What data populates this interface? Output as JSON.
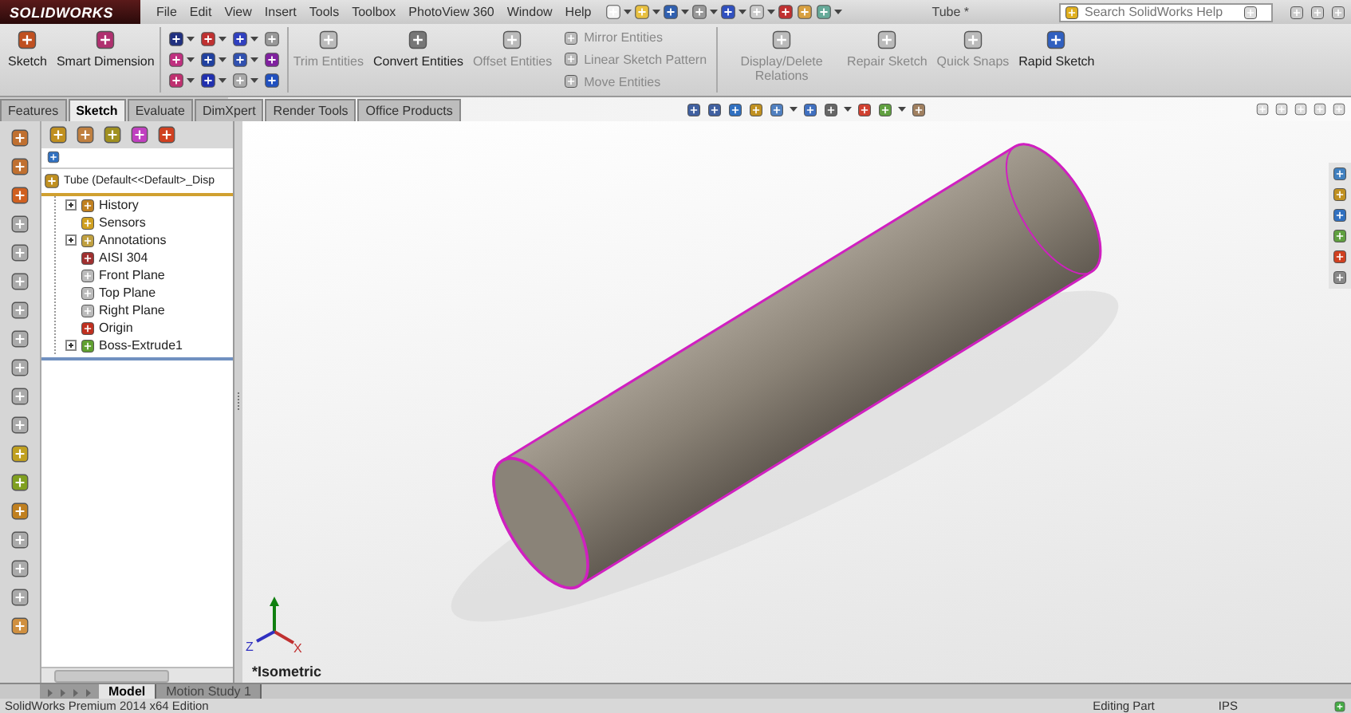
{
  "app": {
    "logo": "SOLIDWORKS",
    "menu": [
      "File",
      "Edit",
      "View",
      "Insert",
      "Tools",
      "Toolbox",
      "PhotoView 360",
      "Window",
      "Help"
    ],
    "document_title": "Tube *",
    "search": {
      "placeholder": "Search SolidWorks Help"
    }
  },
  "command_manager": {
    "commands": [
      {
        "kind": "large",
        "label": "Sketch",
        "disabled": false
      },
      {
        "kind": "large",
        "label": "Smart Dimension",
        "disabled": false
      },
      {
        "kind": "grid"
      },
      {
        "kind": "large",
        "label": "Trim Entities",
        "disabled": true
      },
      {
        "kind": "large",
        "label": "Convert Entities",
        "disabled": false
      },
      {
        "kind": "large",
        "label": "Offset Entities",
        "disabled": true
      },
      {
        "kind": "list",
        "items": [
          {
            "label": "Mirror Entities",
            "disabled": true
          },
          {
            "label": "Linear Sketch Pattern",
            "disabled": true
          },
          {
            "label": "Move Entities",
            "disabled": true
          }
        ]
      },
      {
        "kind": "large",
        "label": "Display/Delete Relations",
        "disabled": true
      },
      {
        "kind": "large",
        "label": "Repair Sketch",
        "disabled": true
      },
      {
        "kind": "large",
        "label": "Quick Snaps",
        "disabled": true
      },
      {
        "kind": "large",
        "label": "Rapid Sketch",
        "disabled": false
      }
    ]
  },
  "tabs": [
    {
      "label": "Features",
      "selected": false
    },
    {
      "label": "Sketch",
      "selected": true
    },
    {
      "label": "Evaluate",
      "selected": false
    },
    {
      "label": "DimXpert",
      "selected": false
    },
    {
      "label": "Render Tools",
      "selected": false
    },
    {
      "label": "Office Products",
      "selected": false
    }
  ],
  "feature_tree": {
    "root": {
      "label": "Tube  (Default<<Default>_Disp",
      "children": [
        {
          "label": "History",
          "expandable": true
        },
        {
          "label": "Sensors",
          "expandable": false
        },
        {
          "label": "Annotations",
          "expandable": true
        },
        {
          "label": "AISI 304",
          "expandable": false
        },
        {
          "label": "Front Plane",
          "expandable": false
        },
        {
          "label": "Top Plane",
          "expandable": false
        },
        {
          "label": "Right Plane",
          "expandable": false
        },
        {
          "label": "Origin",
          "expandable": false
        },
        {
          "label": "Boss-Extrude1",
          "expandable": true
        }
      ]
    }
  },
  "viewport": {
    "view_label": "*Isometric",
    "triad": {
      "z_label": "Z",
      "x_label": "X"
    }
  },
  "bottom_tabs": [
    {
      "label": "Model",
      "selected": true
    },
    {
      "label": "Motion Study 1",
      "selected": false
    }
  ],
  "status_bar": {
    "edition": "SolidWorks Premium 2014 x64 Edition",
    "mode": "Editing Part",
    "units": "IPS"
  }
}
